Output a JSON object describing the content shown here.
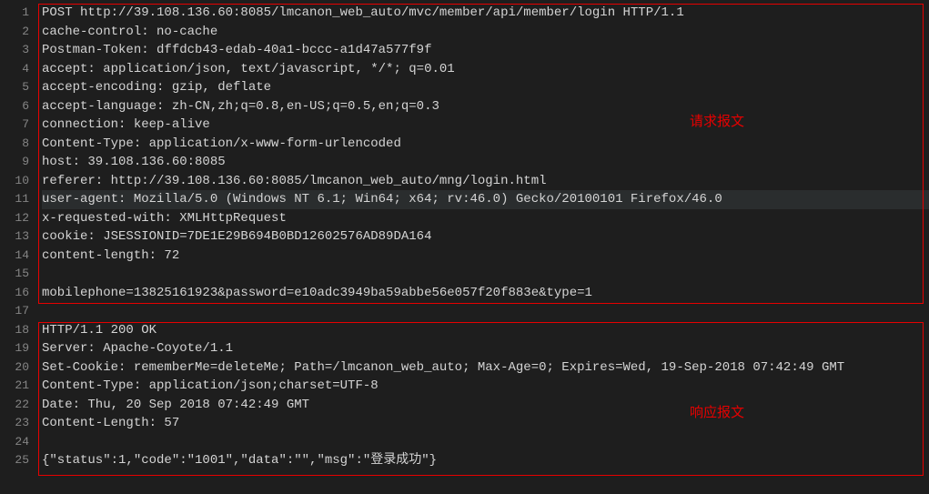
{
  "lines": [
    "POST http://39.108.136.60:8085/lmcanon_web_auto/mvc/member/api/member/login HTTP/1.1",
    "cache-control: no-cache",
    "Postman-Token: dffdcb43-edab-40a1-bccc-a1d47a577f9f",
    "accept: application/json, text/javascript, */*; q=0.01",
    "accept-encoding: gzip, deflate",
    "accept-language: zh-CN,zh;q=0.8,en-US;q=0.5,en;q=0.3",
    "connection: keep-alive",
    "Content-Type: application/x-www-form-urlencoded",
    "host: 39.108.136.60:8085",
    "referer: http://39.108.136.60:8085/lmcanon_web_auto/mng/login.html",
    "user-agent: Mozilla/5.0 (Windows NT 6.1; Win64; x64; rv:46.0) Gecko/20100101 Firefox/46.0",
    "x-requested-with: XMLHttpRequest",
    "cookie: JSESSIONID=7DE1E29B694B0BD12602576AD89DA164",
    "content-length: 72",
    "",
    "mobilephone=13825161923&password=e10adc3949ba59abbe56e057f20f883e&type=1",
    "",
    "HTTP/1.1 200 OK",
    "Server: Apache-Coyote/1.1",
    "Set-Cookie: rememberMe=deleteMe; Path=/lmcanon_web_auto; Max-Age=0; Expires=Wed, 19-Sep-2018 07:42:49 GMT",
    "Content-Type: application/json;charset=UTF-8",
    "Date: Thu, 20 Sep 2018 07:42:49 GMT",
    "Content-Length: 57",
    "",
    "{\"status\":1,\"code\":\"1001\",\"data\":\"\",\"msg\":\"登录成功\"}"
  ],
  "highlighted_line": 11,
  "line_count": 25,
  "annotations": {
    "request": "请求报文",
    "response": "响应报文"
  }
}
